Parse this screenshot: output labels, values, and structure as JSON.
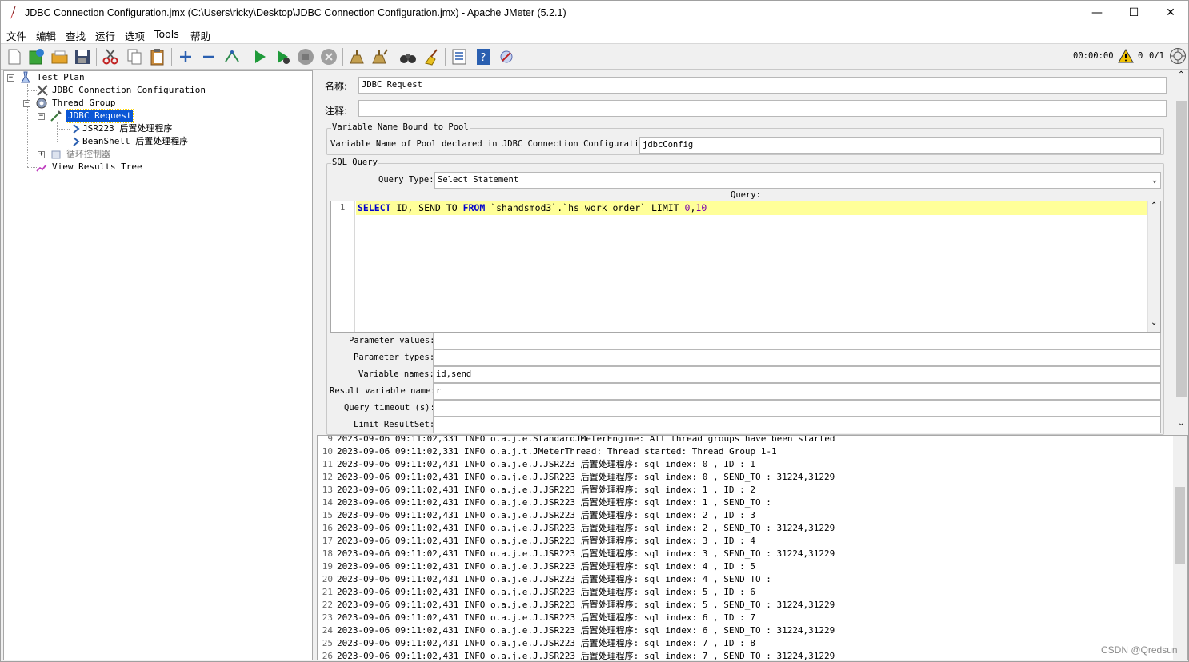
{
  "window": {
    "title": "JDBC Connection Configuration.jmx (C:\\Users\\ricky\\Desktop\\JDBC Connection Configuration.jmx) - Apache JMeter (5.2.1)",
    "controls": {
      "minimize": "—",
      "maximize": "☐",
      "close": "✕"
    }
  },
  "menu": [
    "文件",
    "编辑",
    "查找",
    "运行",
    "选项",
    "Tools",
    "帮助"
  ],
  "toolbar": {
    "timer": "00:00:00",
    "warnings": "0",
    "threads": "0/1",
    "icons": [
      "new-icon",
      "templates-icon",
      "open-icon",
      "save-icon",
      "cut-icon",
      "copy-icon",
      "paste-icon",
      "expand-icon",
      "collapse-icon",
      "toggle-icon",
      "start-icon",
      "start-no-pause-icon",
      "stop-icon",
      "shutdown-icon",
      "clear-icon",
      "clear-all-icon",
      "search-icon",
      "reset-search-icon",
      "function-helper-icon",
      "help-icon",
      "remote-icon"
    ]
  },
  "tree": {
    "items": [
      {
        "label": "Test Plan",
        "icon": "test-plan-icon"
      },
      {
        "label": "JDBC Connection Configuration",
        "icon": "wrench-icon"
      },
      {
        "label": "Thread Group",
        "icon": "gear-icon"
      },
      {
        "label": "JDBC Request",
        "icon": "pipette-icon"
      },
      {
        "label": "JSR223 后置处理程序",
        "icon": "arrow-icon"
      },
      {
        "label": "BeanShell 后置处理程序",
        "icon": "arrow-icon"
      },
      {
        "label": "循环控制器",
        "icon": "loop-icon"
      },
      {
        "label": "View Results Tree",
        "icon": "chart-icon"
      }
    ],
    "selected": "JDBC Request"
  },
  "form": {
    "name_label": "名称:",
    "name_value": "JDBC Request",
    "comment_label": "注释:",
    "comment_value": "",
    "pool_group": "Variable Name Bound to Pool",
    "pool_label": "Variable Name of Pool declared in JDBC Connection Configuration:",
    "pool_value": "jdbcConfig",
    "sql_group": "SQL Query",
    "query_type_label": "Query Type:",
    "query_type_value": "Select Statement",
    "query_label": "Query:",
    "query_line_number": "1",
    "params_values_label": "Parameter values:",
    "params_values_value": "",
    "params_types_label": "Parameter types:",
    "params_types_value": "",
    "var_names_label": "Variable names:",
    "var_names_value": "id,send",
    "result_var_label": "Result variable name:",
    "result_var_value": "r",
    "timeout_label": "Query timeout (s):",
    "timeout_value": "",
    "limit_label": "Limit ResultSet:",
    "limit_value": ""
  },
  "sql": {
    "k1": "SELECT",
    "t1": " ID, SEND_TO ",
    "k2": "FROM",
    "t2": " `shandsmod3`.`hs_work_order` LIMIT ",
    "n1": "0",
    "t3": ",",
    "n2": "10"
  },
  "log": [
    {
      "n": "9",
      "text": "2023-09-06 09:11:02,331 INFO o.a.j.e.StandardJMeterEngine: All thread groups have been started"
    },
    {
      "n": "10",
      "text": "2023-09-06 09:11:02,331 INFO o.a.j.t.JMeterThread: Thread started: Thread Group 1-1"
    },
    {
      "n": "11",
      "text": "2023-09-06 09:11:02,431 INFO o.a.j.e.J.JSR223 后置处理程序: sql index: 0 , ID : 1"
    },
    {
      "n": "12",
      "text": "2023-09-06 09:11:02,431 INFO o.a.j.e.J.JSR223 后置处理程序: sql index: 0 , SEND_TO : 31224,31229"
    },
    {
      "n": "13",
      "text": "2023-09-06 09:11:02,431 INFO o.a.j.e.J.JSR223 后置处理程序: sql index: 1 , ID : 2"
    },
    {
      "n": "14",
      "text": "2023-09-06 09:11:02,431 INFO o.a.j.e.J.JSR223 后置处理程序: sql index: 1 , SEND_TO :"
    },
    {
      "n": "15",
      "text": "2023-09-06 09:11:02,431 INFO o.a.j.e.J.JSR223 后置处理程序: sql index: 2 , ID : 3"
    },
    {
      "n": "16",
      "text": "2023-09-06 09:11:02,431 INFO o.a.j.e.J.JSR223 后置处理程序: sql index: 2 , SEND_TO : 31224,31229"
    },
    {
      "n": "17",
      "text": "2023-09-06 09:11:02,431 INFO o.a.j.e.J.JSR223 后置处理程序: sql index: 3 , ID : 4"
    },
    {
      "n": "18",
      "text": "2023-09-06 09:11:02,431 INFO o.a.j.e.J.JSR223 后置处理程序: sql index: 3 , SEND_TO : 31224,31229"
    },
    {
      "n": "19",
      "text": "2023-09-06 09:11:02,431 INFO o.a.j.e.J.JSR223 后置处理程序: sql index: 4 , ID : 5"
    },
    {
      "n": "20",
      "text": "2023-09-06 09:11:02,431 INFO o.a.j.e.J.JSR223 后置处理程序: sql index: 4 , SEND_TO :"
    },
    {
      "n": "21",
      "text": "2023-09-06 09:11:02,431 INFO o.a.j.e.J.JSR223 后置处理程序: sql index: 5 , ID : 6"
    },
    {
      "n": "22",
      "text": "2023-09-06 09:11:02,431 INFO o.a.j.e.J.JSR223 后置处理程序: sql index: 5 , SEND_TO : 31224,31229"
    },
    {
      "n": "23",
      "text": "2023-09-06 09:11:02,431 INFO o.a.j.e.J.JSR223 后置处理程序: sql index: 6 , ID : 7"
    },
    {
      "n": "24",
      "text": "2023-09-06 09:11:02,431 INFO o.a.j.e.J.JSR223 后置处理程序: sql index: 6 , SEND_TO : 31224,31229"
    },
    {
      "n": "25",
      "text": "2023-09-06 09:11:02,431 INFO o.a.j.e.J.JSR223 后置处理程序: sql index: 7 , ID : 8"
    },
    {
      "n": "26",
      "text": "2023-09-06 09:11:02,431 INFO o.a.j.e.J.JSR223 后置处理程序: sql index: 7 , SEND_TO : 31224,31229"
    }
  ],
  "watermark": "CSDN @Qredsun"
}
